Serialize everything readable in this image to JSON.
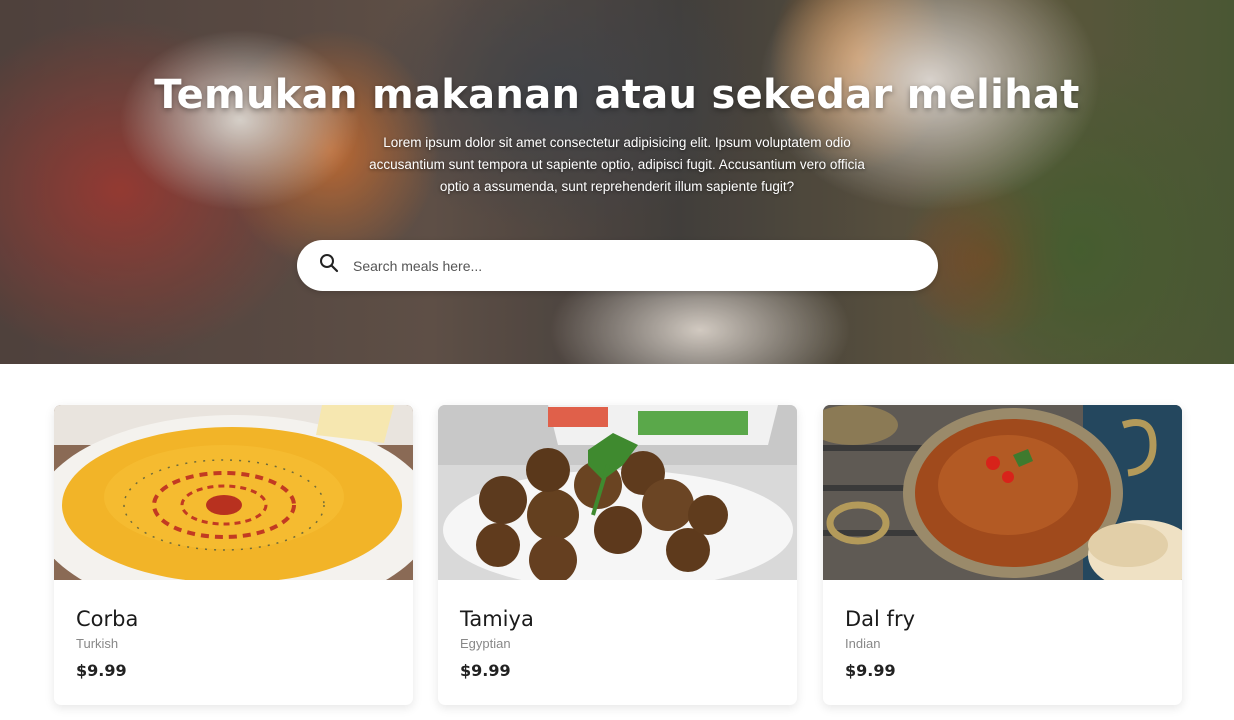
{
  "hero": {
    "title": "Temukan makanan atau sekedar melihat",
    "description": "Lorem ipsum dolor sit amet consectetur adipisicing elit. Ipsum voluptatem odio accusantium sunt tempora ut sapiente optio, adipisci fugit. Accusantium vero officia optio a assumenda, sunt reprehenderit illum sapiente fugit?"
  },
  "search": {
    "placeholder": "Search meals here...",
    "value": "",
    "icon": "search-icon"
  },
  "meals": [
    {
      "name": "Corba",
      "cuisine": "Turkish",
      "price": "$9.99",
      "image": "soup-bowl"
    },
    {
      "name": "Tamiya",
      "cuisine": "Egyptian",
      "price": "$9.99",
      "image": "falafel-plate"
    },
    {
      "name": "Dal fry",
      "cuisine": "Indian",
      "price": "$9.99",
      "image": "dal-curry-pan"
    }
  ],
  "colors": {
    "text_primary": "#1a1a1a",
    "text_muted": "#888888",
    "hero_text": "#ffffff"
  }
}
